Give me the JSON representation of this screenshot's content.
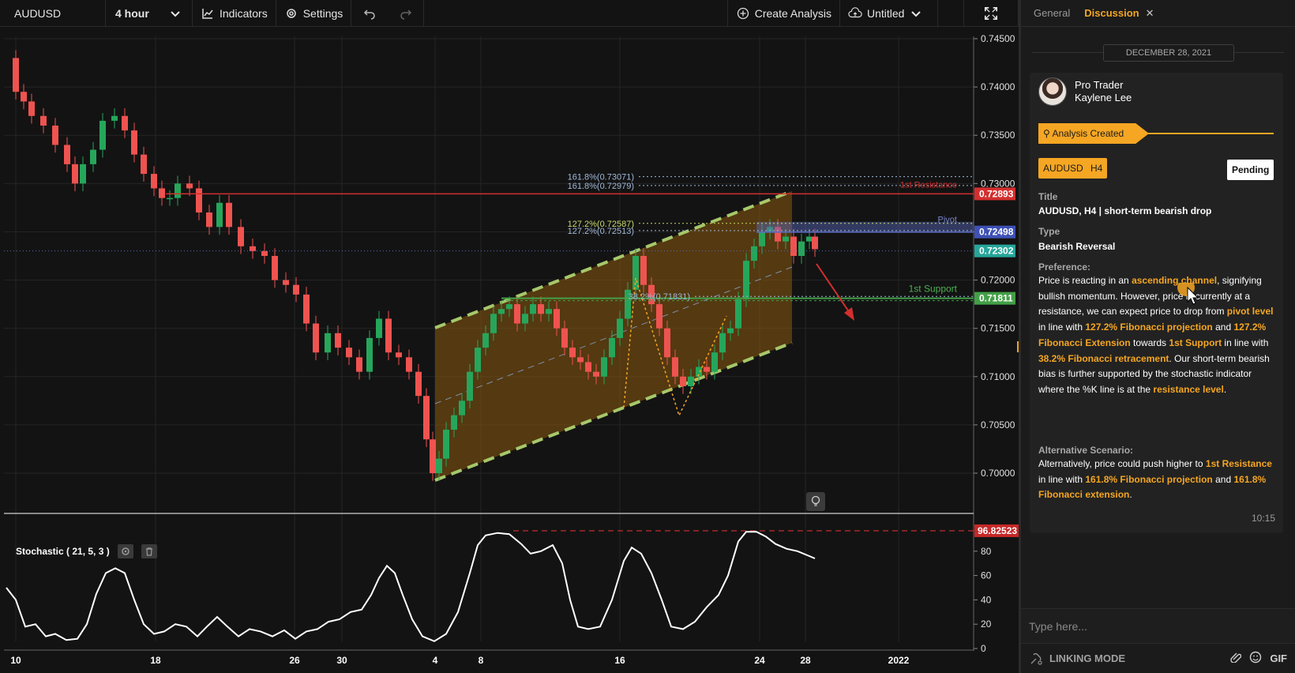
{
  "toolbar": {
    "symbol": "AUDUSD",
    "interval": "4 hour",
    "indicators_label": "Indicators",
    "settings_label": "Settings",
    "create_label": "Create Analysis",
    "layout_label": "Untitled"
  },
  "chart": {
    "price_labels": [
      "0.74500",
      "0.74000",
      "0.73500",
      "0.73000",
      "0.72500",
      "0.72000",
      "0.71500",
      "0.71000",
      "0.70500",
      "0.70000"
    ],
    "date_labels": [
      "10",
      "18",
      "26",
      "30",
      "4",
      "8",
      "16",
      "24",
      "28",
      "2022"
    ],
    "stoch_labels": [
      "80",
      "60",
      "40",
      "20",
      "0"
    ],
    "price_tags": [
      {
        "value": "0.72893",
        "color": "#d32f2f"
      },
      {
        "value": "0.72498",
        "color": "#3f51b5"
      },
      {
        "value": "0.72302",
        "color": "#26a69a"
      },
      {
        "value": "0.71811",
        "color": "#43a047"
      }
    ],
    "stoch_tag": "96.82523",
    "fib_labels": [
      "161.8%(0.73071)",
      "161.8%(0.72979)",
      "127.2%(0.72587)",
      "127.2%(0.72513)",
      "38.2%(0.71831)"
    ],
    "level_labels": {
      "resistance": "1st Resistance",
      "pivot": "Pivot",
      "support": "1st Support"
    },
    "stoch_legend": "Stochastic ( 21, 5, 3 )",
    "colors": {
      "bull": "#26a65b",
      "bear": "#ef5350",
      "channel": "#a6c86b",
      "fill": "#8a5a10"
    }
  },
  "panel": {
    "tabs": [
      {
        "label": "General"
      },
      {
        "label": "Discussion"
      }
    ],
    "date": "DECEMBER 28, 2021",
    "author_role": "Pro Trader",
    "author_name": "Kaylene Lee",
    "banner": "Analysis Created",
    "chip_symbol": "AUDUSD",
    "chip_tf": "H4",
    "status": "Pending",
    "title_label": "Title",
    "title_value": "AUDUSD, H4 | short-term bearish drop",
    "type_label": "Type",
    "type_value": "Bearish Reversal",
    "pref_label": "Preference:",
    "pref": [
      {
        "t": "Price is reacting in an ",
        "h": false
      },
      {
        "t": "ascending channel",
        "h": true
      },
      {
        "t": ", signifying bullish momentum. However, price is currently at a resistance, we can expect price to drop from ",
        "h": false
      },
      {
        "t": "pivot level",
        "h": true
      },
      {
        "t": " in line with ",
        "h": false
      },
      {
        "t": "127.2% Fibonacci projection",
        "h": true
      },
      {
        "t": " and ",
        "h": false
      },
      {
        "t": "127.2% Fibonacci Extension",
        "h": true
      },
      {
        "t": " towards ",
        "h": false
      },
      {
        "t": "1st Support",
        "h": true
      },
      {
        "t": " in line with ",
        "h": false
      },
      {
        "t": "38.2% Fibonacci retracement",
        "h": true
      },
      {
        "t": ". Our short-term bearish bias is further supported by the stochastic indicator where the %K line is at the ",
        "h": false
      },
      {
        "t": "resistance level",
        "h": true
      },
      {
        "t": ".",
        "h": false
      }
    ],
    "alt_label": "Alternative Scenario:",
    "alt": [
      {
        "t": "Alternatively, price could push higher to ",
        "h": false
      },
      {
        "t": "1st Resistance",
        "h": true
      },
      {
        "t": " in line with ",
        "h": false
      },
      {
        "t": "161.8% Fibonacci projection",
        "h": true
      },
      {
        "t": " and ",
        "h": false
      },
      {
        "t": "161.8% Fibonacci extension",
        "h": true
      },
      {
        "t": ".",
        "h": false
      }
    ],
    "time": "10:15",
    "input_placeholder": "Type here...",
    "linking_label": "LINKING MODE",
    "gif_label": "GIF"
  }
}
